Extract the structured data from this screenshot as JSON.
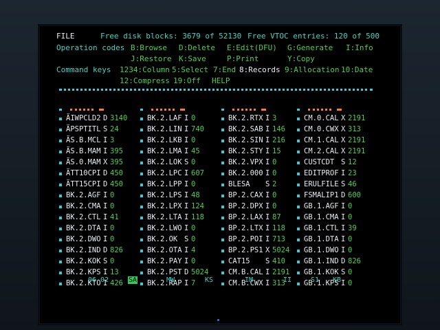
{
  "header": {
    "file": "FILE",
    "free_disk": "Free disk blocks: 3679 of 52130",
    "free_vtoc": "Free VTOC entries:  120 of 500"
  },
  "operation": {
    "label": "Operation codes",
    "items": [
      "B:Browse",
      "D:Delete",
      "E:Edit(DFU)",
      "G:Generate",
      "I:Info",
      "J:Restore",
      "K:Save",
      "P:Print",
      "Y:Copy"
    ]
  },
  "command": {
    "label": "Command keys",
    "items": [
      "1234:Column",
      "5:Select",
      "7:End",
      "8:Records",
      "9:Allocation",
      "10:Date",
      "12:Compress",
      "19:Off",
      "HELP"
    ]
  },
  "columns": [
    [
      {
        "name": "ÄIWPCLD2",
        "flag": "D",
        "value": "3140"
      },
      {
        "name": "ÄPSPTITL",
        "flag": "S",
        "value": "24"
      },
      {
        "name": "ÄS.B.MCL",
        "flag": "I",
        "value": "3"
      },
      {
        "name": "ÄS.B.MAM",
        "flag": "I",
        "value": "395"
      },
      {
        "name": "ÄS.0.MAM",
        "flag": "X",
        "value": "395"
      },
      {
        "name": "ÄTT10CPI",
        "flag": "D",
        "value": "450"
      },
      {
        "name": "ÄTT15CPI",
        "flag": "D",
        "value": "450"
      },
      {
        "name": "BK.2.AGF",
        "flag": "I",
        "value": "0"
      },
      {
        "name": "BK.2.CMA",
        "flag": "I",
        "value": "0"
      },
      {
        "name": "BK.2.CTL",
        "flag": "I",
        "value": "41"
      },
      {
        "name": "BK.2.DTA",
        "flag": "I",
        "value": "0"
      },
      {
        "name": "BK.2.DWO",
        "flag": "I",
        "value": "0"
      },
      {
        "name": "BK.2.IND",
        "flag": "D",
        "value": "826"
      },
      {
        "name": "BK.2.KOK",
        "flag": "S",
        "value": "0"
      },
      {
        "name": "BK.2.KPS",
        "flag": "I",
        "value": "13"
      },
      {
        "name": "BK.2.KTO",
        "flag": "I",
        "value": "426"
      }
    ],
    [
      {
        "name": "BK.2.LAF",
        "flag": "I",
        "value": "0"
      },
      {
        "name": "BK.2.LIN",
        "flag": "I",
        "value": "740"
      },
      {
        "name": "BK.2.LKB",
        "flag": "I",
        "value": "0"
      },
      {
        "name": "BK.2.LMA",
        "flag": "I",
        "value": "45"
      },
      {
        "name": "BK.2.LOK",
        "flag": "S",
        "value": "0"
      },
      {
        "name": "BK.2.LPC",
        "flag": "I",
        "value": "607"
      },
      {
        "name": "BK.2.LPP",
        "flag": "I",
        "value": "0"
      },
      {
        "name": "BK.2.LPS",
        "flag": "I",
        "value": "48"
      },
      {
        "name": "BK.2.LPX",
        "flag": "I",
        "value": "124"
      },
      {
        "name": "BK.2.LTA",
        "flag": "I",
        "value": "118"
      },
      {
        "name": "BK.2.LWO",
        "flag": "I",
        "value": "0"
      },
      {
        "name": "BK.2.OK",
        "flag": "S",
        "value": "0"
      },
      {
        "name": "BK.2.OTA",
        "flag": "I",
        "value": "4"
      },
      {
        "name": "BK.2.PAY",
        "flag": "I",
        "value": "0"
      },
      {
        "name": "BK.2.PST",
        "flag": "D",
        "value": "5024"
      },
      {
        "name": "BK.2.RAP",
        "flag": "I",
        "value": "7"
      }
    ],
    [
      {
        "name": "BK.2.RTX",
        "flag": "I",
        "value": "3"
      },
      {
        "name": "BK.2.SAB",
        "flag": "I",
        "value": "146"
      },
      {
        "name": "BK.2.SIN",
        "flag": "I",
        "value": "216"
      },
      {
        "name": "BK.2.STY",
        "flag": "I",
        "value": "15"
      },
      {
        "name": "BK.2.VPX",
        "flag": "I",
        "value": "0"
      },
      {
        "name": "BK.2.000",
        "flag": "I",
        "value": "0"
      },
      {
        "name": "BLESA",
        "flag": "S",
        "value": "2"
      },
      {
        "name": "BP.2.CAX",
        "flag": "I",
        "value": "0"
      },
      {
        "name": "BP.2.DPX",
        "flag": "I",
        "value": "0"
      },
      {
        "name": "BP.2.LAX",
        "flag": "I",
        "value": "87"
      },
      {
        "name": "BP.2.LTX",
        "flag": "I",
        "value": "118"
      },
      {
        "name": "BP.2.POI",
        "flag": "I",
        "value": "713"
      },
      {
        "name": "BP.2.PS1",
        "flag": "X",
        "value": "5024"
      },
      {
        "name": "CAT15",
        "flag": "S",
        "value": "410"
      },
      {
        "name": "CM.B.CAL",
        "flag": "I",
        "value": "2191"
      },
      {
        "name": "CM.B.CWX",
        "flag": "I",
        "value": "313"
      }
    ],
    [
      {
        "name": "CM.0.CAL",
        "flag": "X",
        "value": "2191"
      },
      {
        "name": "CM.0.CWX",
        "flag": "X",
        "value": "313"
      },
      {
        "name": "CM.1.CAL",
        "flag": "X",
        "value": "2191"
      },
      {
        "name": "CM.2.CAL",
        "flag": "X",
        "value": "2191"
      },
      {
        "name": "CUSTCDT",
        "flag": "S",
        "value": "12"
      },
      {
        "name": "EDITPROF",
        "flag": "I",
        "value": "23"
      },
      {
        "name": "ERULFILE",
        "flag": "S",
        "value": "46"
      },
      {
        "name": "FSMALIP1",
        "flag": "D",
        "value": "600"
      },
      {
        "name": "GB.1.AGF",
        "flag": "I",
        "value": "0"
      },
      {
        "name": "GB.1.CMA",
        "flag": "I",
        "value": "0"
      },
      {
        "name": "GB.1.CTL",
        "flag": "I",
        "value": "39"
      },
      {
        "name": "GB.1.DTA",
        "flag": "I",
        "value": "0"
      },
      {
        "name": "GB.1.DWO",
        "flag": "I",
        "value": "0"
      },
      {
        "name": "GB.1.IND",
        "flag": "D",
        "value": "826"
      },
      {
        "name": "GB.1.KOK",
        "flag": "S",
        "value": "0"
      },
      {
        "name": "GB.1.KPS",
        "flag": "I",
        "value": "0"
      }
    ]
  ],
  "footer": {
    "items": [
      "06-02",
      "SA",
      "MW",
      "KS",
      "IM",
      "II",
      "S1",
      "KB"
    ],
    "selected": "SA"
  }
}
